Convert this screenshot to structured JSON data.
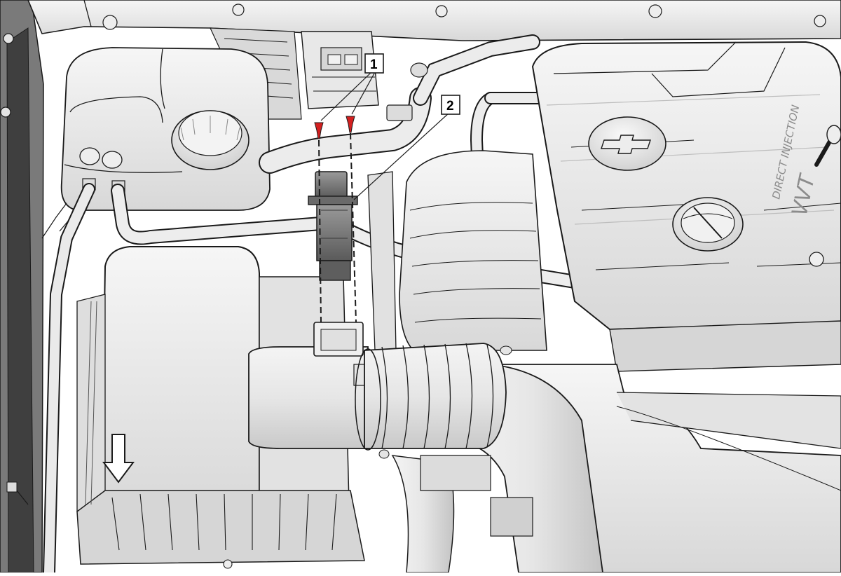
{
  "callouts": [
    {
      "label": "1",
      "meaning": "fasteners"
    },
    {
      "label": "2",
      "meaning": "sensor"
    }
  ],
  "engine_cover": {
    "emblem_text": "DIRECT INJECTION",
    "logo_text": "VVT"
  },
  "reservoir_caps": {
    "left": "",
    "right": ""
  },
  "colors": {
    "line_art": "#1a1a1a",
    "part_fill": "#ececec",
    "part_shade": "#d2d2d2",
    "background": "#ffffff",
    "fastener": "#d42020",
    "sensor": "#6e6e6e"
  },
  "icons": [
    "direction-arrow-down-icon",
    "chevrolet-bowtie-icon"
  ]
}
